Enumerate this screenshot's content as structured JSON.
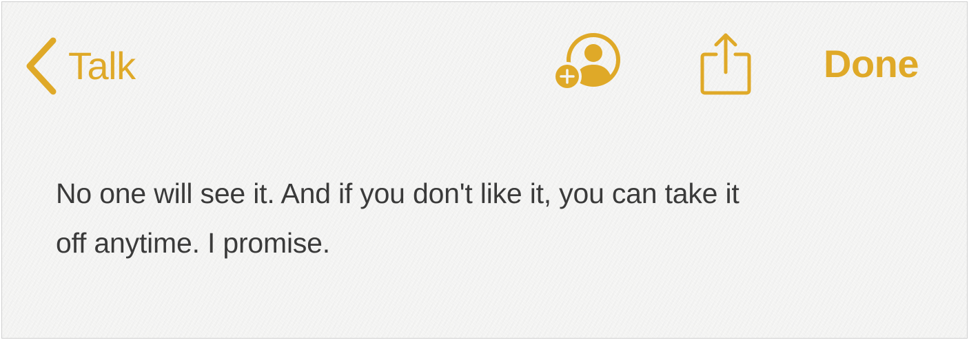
{
  "toolbar": {
    "back_label": "Talk",
    "done_label": "Done",
    "add_person_icon": "add-person-icon",
    "share_icon": "share-icon",
    "back_icon": "chevron-left-icon"
  },
  "note": {
    "line1": "No one will see it. And if you don't like it, you can take it",
    "line2": "off anytime. I promise."
  },
  "colors": {
    "accent": "#dfa928",
    "text": "#3a3a3a",
    "paper": "#f4f4f3"
  }
}
